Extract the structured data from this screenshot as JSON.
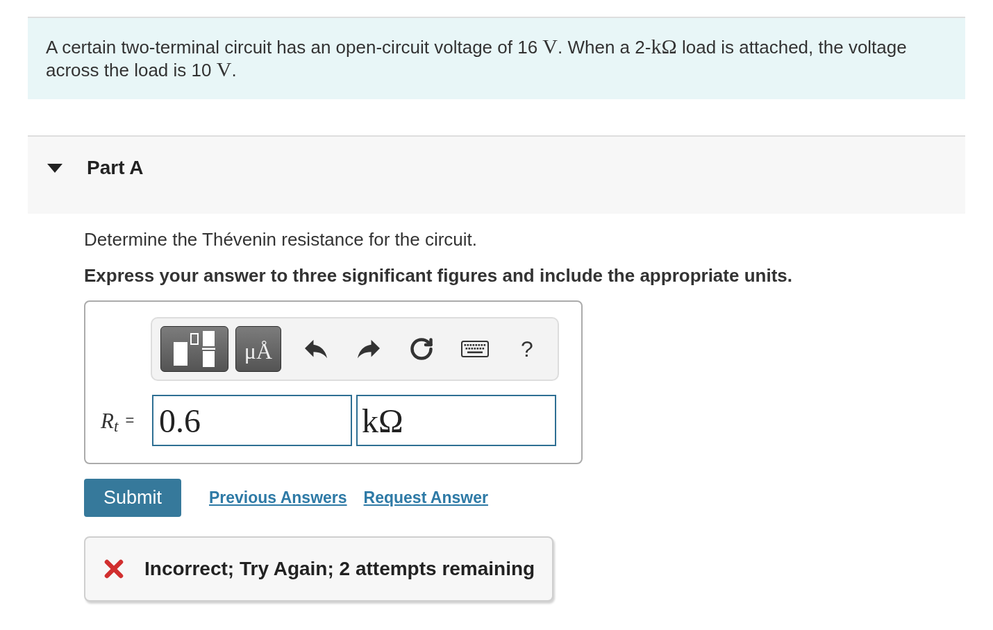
{
  "problem": {
    "segments": [
      {
        "kind": "text",
        "text": "A certain two-terminal circuit has an open-circuit voltage of 16 "
      },
      {
        "kind": "math",
        "text": "V"
      },
      {
        "kind": "text",
        "text": ". When a 2-"
      },
      {
        "kind": "math",
        "text": "kΩ"
      },
      {
        "kind": "text",
        "text": " load is attached, the voltage across the load is 10 "
      },
      {
        "kind": "math",
        "text": "V"
      },
      {
        "kind": "text",
        "text": "."
      }
    ]
  },
  "part": {
    "title": "Part A",
    "expanded": true
  },
  "question": "Determine the Thévenin resistance for the circuit.",
  "instruction": "Express your answer to three significant figures and include the appropriate units.",
  "answer": {
    "toolbar": {
      "units_label": "μÅ",
      "help_label": "?"
    },
    "variable": "R$_{t}$",
    "relation": "=",
    "value": "0.6",
    "unit": "kΩ"
  },
  "actions": {
    "submit": "Submit",
    "links": [
      "Previous Answers",
      "Request Answer"
    ]
  },
  "feedback": {
    "kind": "incorrect",
    "text": "Incorrect; Try Again; 2 attempts remaining"
  }
}
